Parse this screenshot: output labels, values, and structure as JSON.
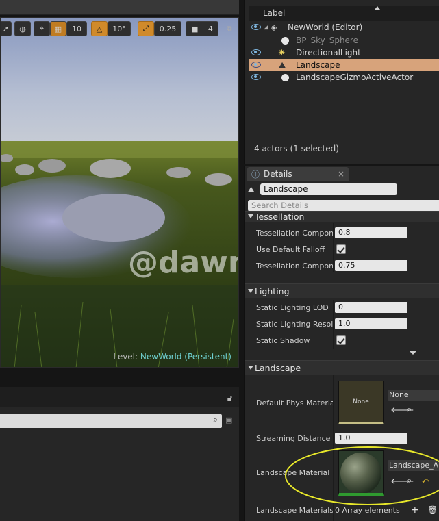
{
  "viewport": {
    "toolbar": {
      "grid_snap": "10",
      "rotation_snap": "10°",
      "scale_snap": "0.25",
      "camera_speed": "4"
    },
    "level_label": "Level:",
    "level_name": "NewWorld (Persistent)",
    "watermark": "@dawn_arc"
  },
  "outliner": {
    "column_label": "Label",
    "items": [
      {
        "label": "NewWorld (Editor)",
        "icon": "world-icon"
      },
      {
        "label": "BP_Sky_Sphere",
        "icon": "sphere-icon"
      },
      {
        "label": "DirectionalLight",
        "icon": "light-icon"
      },
      {
        "label": "Landscape",
        "icon": "landscape-icon"
      },
      {
        "label": "LandscapeGizmoActiveActor",
        "icon": "sphere-icon"
      }
    ],
    "footer": "4 actors (1 selected)"
  },
  "details": {
    "tab_label": "Details",
    "name_value": "Landscape",
    "search_placeholder": "Search Details",
    "tessellation": {
      "title": "Tessellation",
      "rows": [
        {
          "label": "Tessellation Compone",
          "value": "0.8"
        },
        {
          "label": "Use Default Falloff"
        },
        {
          "label": "Tessellation Compone",
          "value": "0.75"
        }
      ]
    },
    "lighting": {
      "title": "Lighting",
      "rows": [
        {
          "label": "Static Lighting LOD",
          "value": "0"
        },
        {
          "label": "Static Lighting Resolut",
          "value": "1.0"
        },
        {
          "label": "Static Shadow"
        }
      ]
    },
    "landscape": {
      "title": "Landscape",
      "phys_label": "Default Phys Material",
      "phys_thumb": "None",
      "phys_value": "None",
      "streaming_label": "Streaming Distance M",
      "streaming_value": "1.0",
      "material_label": "Landscape Material",
      "material_value": "Landscape_Au",
      "materials_label": "Landscape Materials C",
      "materials_value": "0 Array elements"
    }
  },
  "colors": {
    "selection": "#d7a37b",
    "toolbar_active": "#d08a2a",
    "annotation": "#e8e82a",
    "level_name": "#6fd0d0"
  }
}
